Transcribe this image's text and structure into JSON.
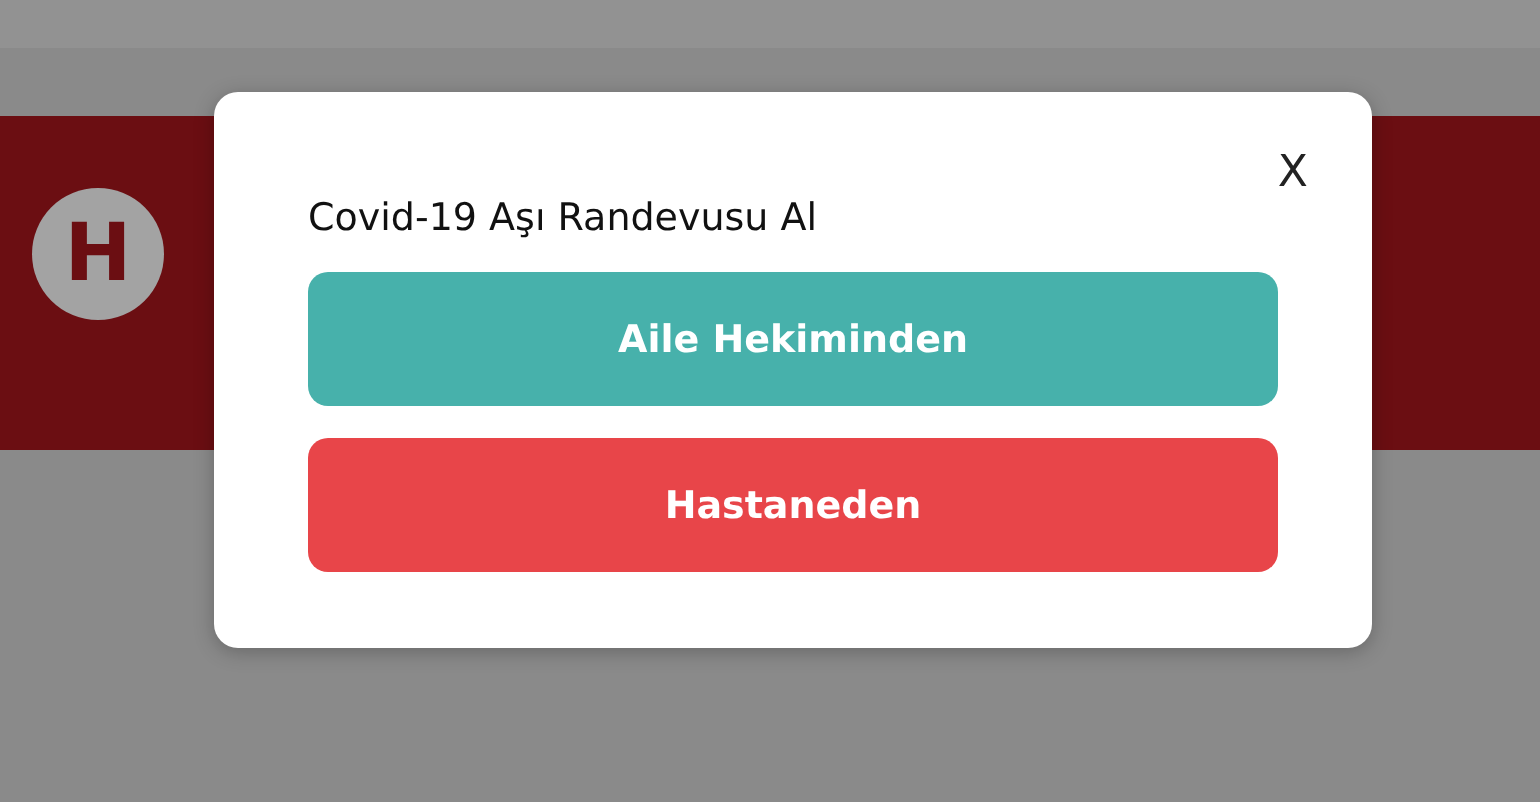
{
  "header": {
    "logo_letter": "H"
  },
  "modal": {
    "title": "Covid-19 Aşı Randevusu Al",
    "close": "X",
    "buttons": [
      {
        "label": "Aile Hekiminden",
        "color": "#47b1ab"
      },
      {
        "label": "Hastaneden",
        "color": "#e84549"
      }
    ]
  }
}
